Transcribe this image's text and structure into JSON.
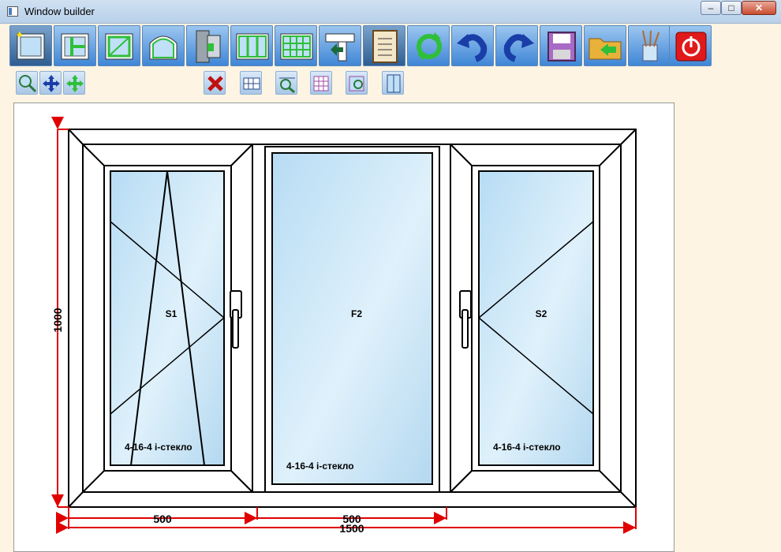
{
  "window": {
    "title": "Window builder",
    "minimize_label": "–",
    "maximize_label": "□",
    "close_label": "✕"
  },
  "toolbar_main": [
    {
      "icon": "new-window-icon"
    },
    {
      "icon": "mullion-icon"
    },
    {
      "icon": "sash-icon"
    },
    {
      "icon": "arch-icon"
    },
    {
      "icon": "door-icon"
    },
    {
      "icon": "multi-section-icon"
    },
    {
      "icon": "grid-section-icon"
    },
    {
      "icon": "profile-connector-icon"
    },
    {
      "icon": "properties-list-icon",
      "active": true
    },
    {
      "icon": "refresh-icon"
    },
    {
      "icon": "undo-icon"
    },
    {
      "icon": "redo-icon"
    },
    {
      "icon": "save-icon"
    },
    {
      "icon": "open-folder-icon"
    },
    {
      "icon": "paint-tools-icon"
    },
    {
      "icon": "power-exit-icon"
    }
  ],
  "toolbar_secondary": [
    {
      "icon": "zoom-in-icon"
    },
    {
      "icon": "pan-icon"
    },
    {
      "icon": "move-icon"
    },
    {
      "icon": "delete-icon"
    },
    {
      "icon": "table-grid-icon"
    },
    {
      "icon": "dimension-zoom-icon"
    },
    {
      "icon": "grid-settings-icon"
    },
    {
      "icon": "glass-settings-icon"
    },
    {
      "icon": "view-panel-icon"
    }
  ],
  "drawing": {
    "dimensions": {
      "height": "1000",
      "width_left": "500",
      "width_center": "500",
      "width_total": "1500"
    },
    "sashes": [
      {
        "label": "S1",
        "glass": "4-16-4 і-стекло",
        "opening": "tilt-turn"
      },
      {
        "label": "F2",
        "glass": "4-16-4 і-стекло",
        "opening": "fixed"
      },
      {
        "label": "S2",
        "glass": "4-16-4 і-стекло",
        "opening": "turn"
      }
    ],
    "colors": {
      "dimension": "#e00000",
      "glass": "#bfe0f6",
      "frame": "#ffffff",
      "outline": "#000000"
    }
  }
}
